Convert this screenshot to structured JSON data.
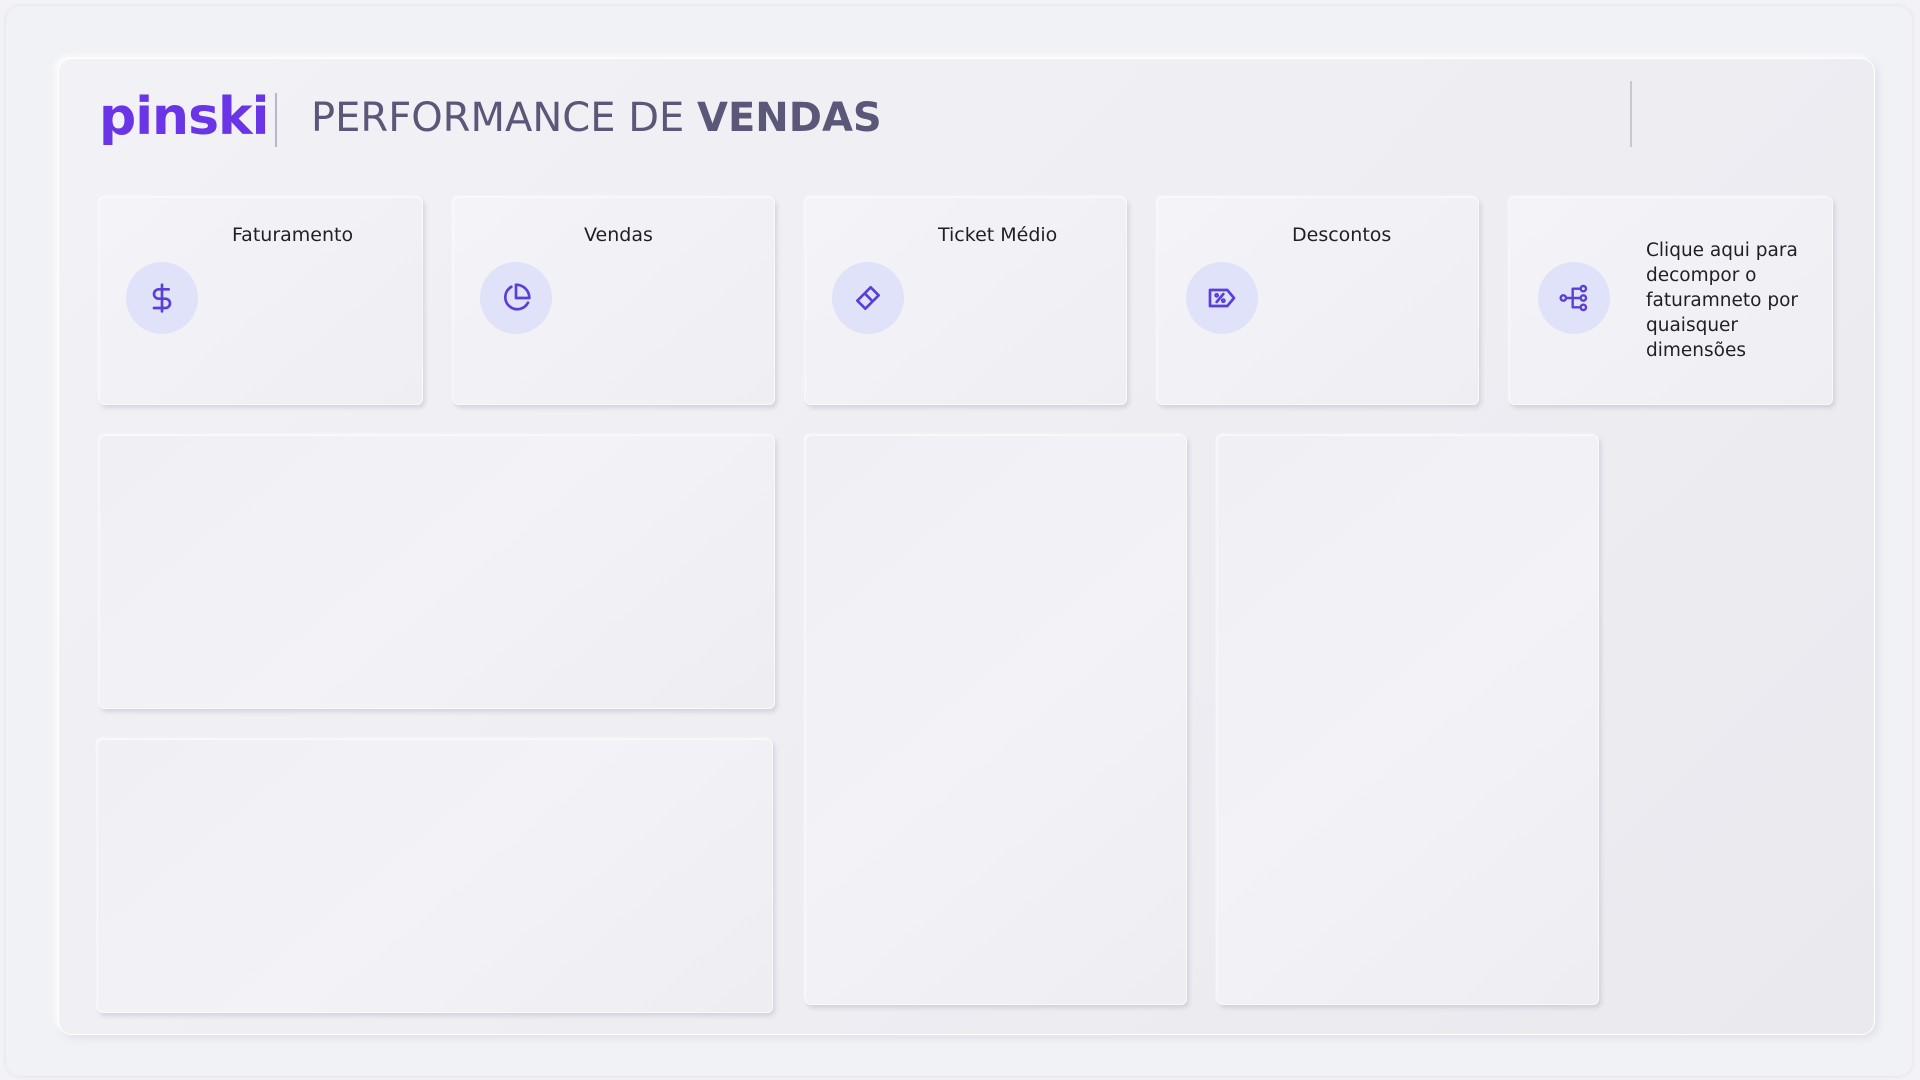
{
  "brand": {
    "logo_text": "pinski"
  },
  "header": {
    "title_regular": "PERFORMANCE DE ",
    "title_bold": "VENDAS"
  },
  "kpis": [
    {
      "title": "Faturamento",
      "icon": "dollar-icon"
    },
    {
      "title": "Vendas",
      "icon": "pie-chart-icon"
    },
    {
      "title": "Ticket Médio",
      "icon": "ticket-icon"
    },
    {
      "title": "Descontos",
      "icon": "discount-tag-icon"
    }
  ],
  "decomposition": {
    "icon": "decomposition-tree-icon",
    "text": "Clique aqui para decompor o faturamneto por quaisquer dimensões"
  },
  "colors": {
    "accent": "#6a35e6",
    "title": "#5b5778",
    "icon_bg": "#dfe2f8",
    "background": "#f1f2f6"
  }
}
